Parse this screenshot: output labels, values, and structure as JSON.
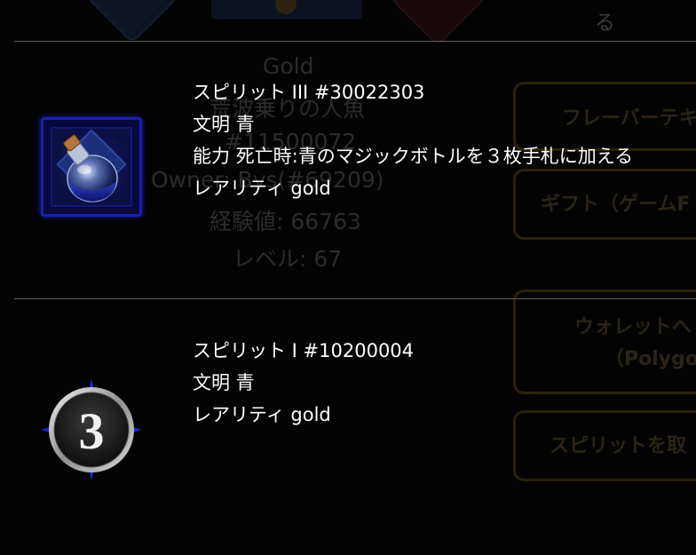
{
  "background": {
    "top_fragment": "る",
    "details": {
      "rarity": "Gold",
      "name": "荒波乗りの人魚",
      "id": "#11500072",
      "owner": "Owner: Bys(#69209)",
      "exp": "経験値: 66763",
      "level": "レベル: 67"
    },
    "buttons": [
      "フレーバーテキ",
      "ギフト（ゲームF",
      "ウォレットへ",
      "（Polygon",
      "スピリットを取"
    ]
  },
  "cards": [
    {
      "title": "スピリット III #30022303",
      "civilization": "文明 青",
      "ability": "能力 死亡時:青のマジックボトルを３枚手札に加える",
      "rarity": "レアリティ gold",
      "icon": "blue-potion-bottle-icon"
    },
    {
      "title": "スピリット I #10200004",
      "civilization": "文明 青",
      "rarity": "レアリティ gold",
      "icon": "number-badge-icon",
      "badge_number": "3"
    }
  ],
  "colors": {
    "background": "#030303",
    "text": "#ffffff",
    "divider": "#5a5a5a",
    "card_border_blue": "#1a1fb0",
    "muted_gold": "#2b2206"
  }
}
